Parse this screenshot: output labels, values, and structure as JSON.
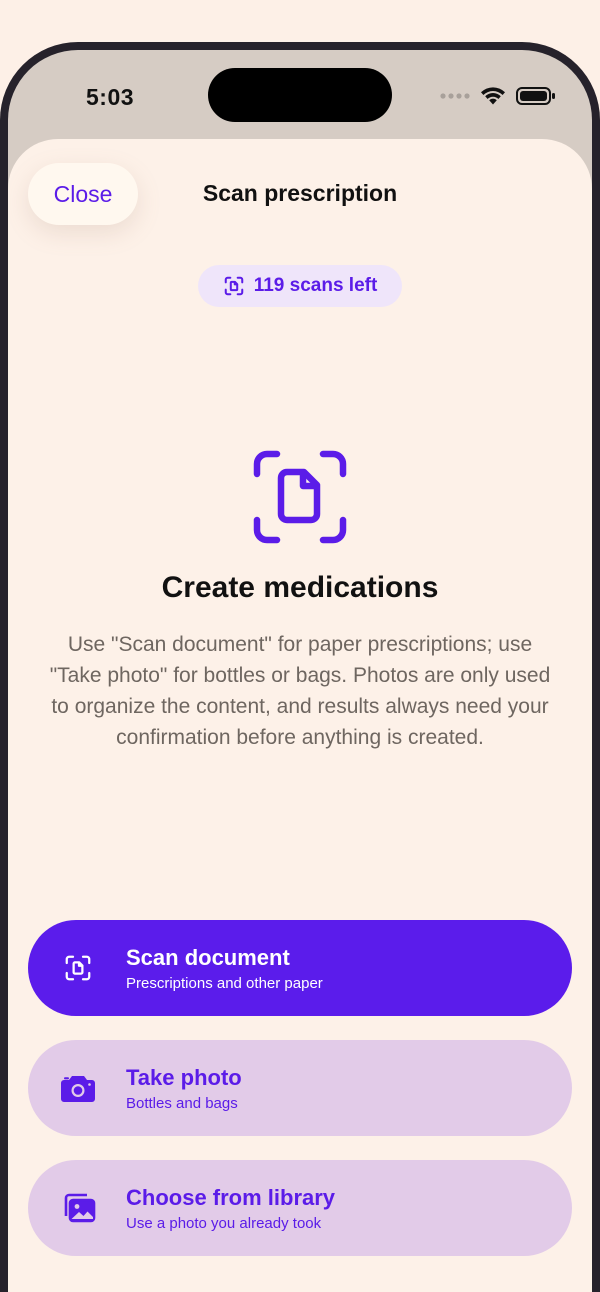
{
  "status_bar": {
    "time": "5:03"
  },
  "header": {
    "close_label": "Close",
    "title": "Scan prescription"
  },
  "scans_badge": {
    "label": "119 scans left"
  },
  "hero": {
    "icon": "document-scan-icon",
    "title": "Create medications",
    "description": "Use \"Scan document\" for paper prescriptions; use \"Take photo\" for bottles or bags. Photos are only used to organize the content, and results always need your confirmation before anything is created."
  },
  "actions": [
    {
      "icon": "document-scan-icon",
      "label": "Scan document",
      "subtitle": "Prescriptions and other paper"
    },
    {
      "icon": "camera-icon",
      "label": "Take photo",
      "subtitle": "Bottles and bags"
    },
    {
      "icon": "photo-library-icon",
      "label": "Choose from library",
      "subtitle": "Use a photo you already took"
    }
  ],
  "colors": {
    "accent": "#5B1CEB",
    "secondary_button": "#E2CBE8",
    "sheet_background": "#FDF1E8",
    "badge_background": "#EFE5FA"
  }
}
